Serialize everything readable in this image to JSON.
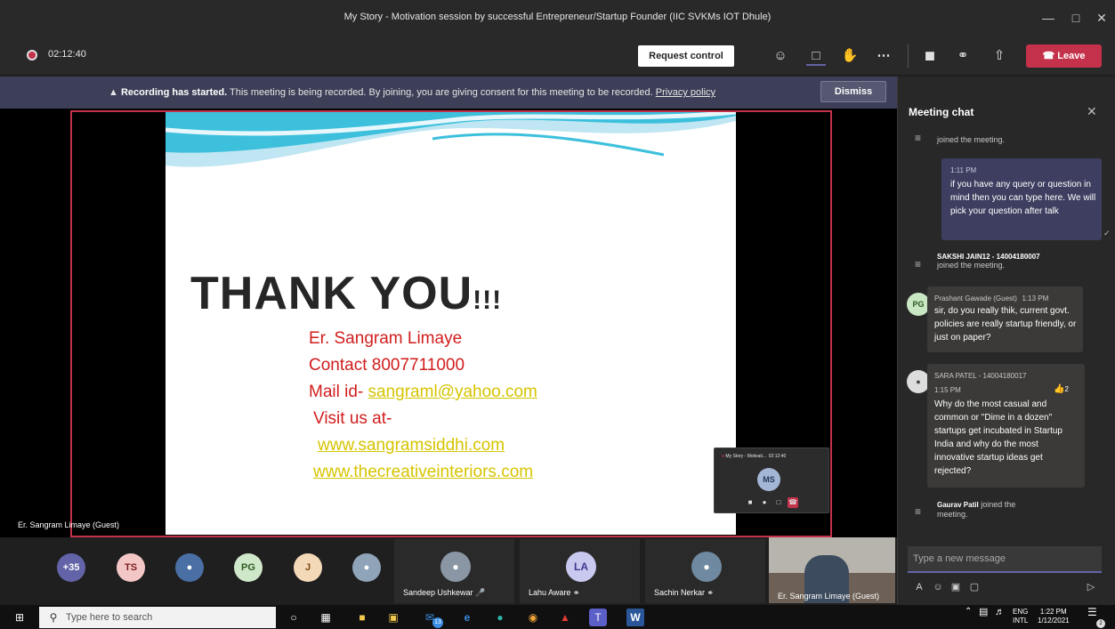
{
  "window": {
    "title": "My Story - Motivation session by successful Entrepreneur/Startup Founder (IIC SVKMs IOT Dhule)"
  },
  "toolbar": {
    "timer": "02:12:40",
    "request_control": "Request control",
    "leave": "Leave"
  },
  "banner": {
    "bold": "Recording has started.",
    "text": " This meeting is being recorded. By joining, you are giving consent for this meeting to be recorded. ",
    "link": "Privacy policy",
    "dismiss": "Dismiss"
  },
  "slide": {
    "heading": "THANK YOU",
    "heading_suffix": "!!!",
    "name": "Er. Sangram Limaye",
    "contact": "Contact 8007711000",
    "mail_prefix": "Mail id- ",
    "mail": "sangraml@yahoo.com",
    "visit": "Visit us at-",
    "site1": "www.sangramsiddhi.com",
    "site2": "www.thecreativeinteriors.com"
  },
  "stage": {
    "speaker_label": "Er. Sangram Limaye (Guest)"
  },
  "pip": {
    "title": "My Story - Motivati...",
    "time": "02:12:40",
    "initials": "MS"
  },
  "participants": {
    "overflow": "+35",
    "ts": "TS",
    "pg": "PG",
    "j": "J",
    "la": "LA",
    "tiles": [
      {
        "name": "Sandeep Ushkewar"
      },
      {
        "name": "Lahu Aware"
      },
      {
        "name": "Sachin Nerkar"
      },
      {
        "name": "Er. Sangram Limaye (Guest)"
      }
    ]
  },
  "chat": {
    "title": "Meeting chat",
    "sys0": "joined the meeting.",
    "mine_time": "1:11 PM",
    "mine_text": "if you have any query or question in mind then you can type here. We will pick your question after talk",
    "sys1_name": "SAKSHI JAIN12 - 14004180007",
    "sys1_text": "joined the meeting.",
    "m1_author": "Prashant Gawade (Guest)",
    "m1_time": "1:13 PM",
    "m1_initials": "PG",
    "m1_text": "sir, do you really thik, current govt. policies are really startup friendly, or just on paper?",
    "m2_author": "SARA PATEL - 14004180017",
    "m2_time": "1:15 PM",
    "m2_likes": "2",
    "m2_text": "Why do the most casual and common or \"Dime in a dozen\" startups get incubated in Startup India and why do the most innovative startup ideas get rejected?",
    "sys2_name": "Gaurav Patil",
    "sys2_text": " joined the meeting.",
    "compose_placeholder": "Type a new message"
  },
  "taskbar": {
    "search_placeholder": "Type here to search",
    "lang1": "ENG",
    "lang2": "INTL",
    "time": "1:22 PM",
    "date": "1/12/2021",
    "badge": "13",
    "notif": "2"
  },
  "colors": {
    "leave": "#c4314b",
    "accent": "#6264a7",
    "slide_red": "#d11d1d",
    "slide_link": "#d6c400"
  }
}
